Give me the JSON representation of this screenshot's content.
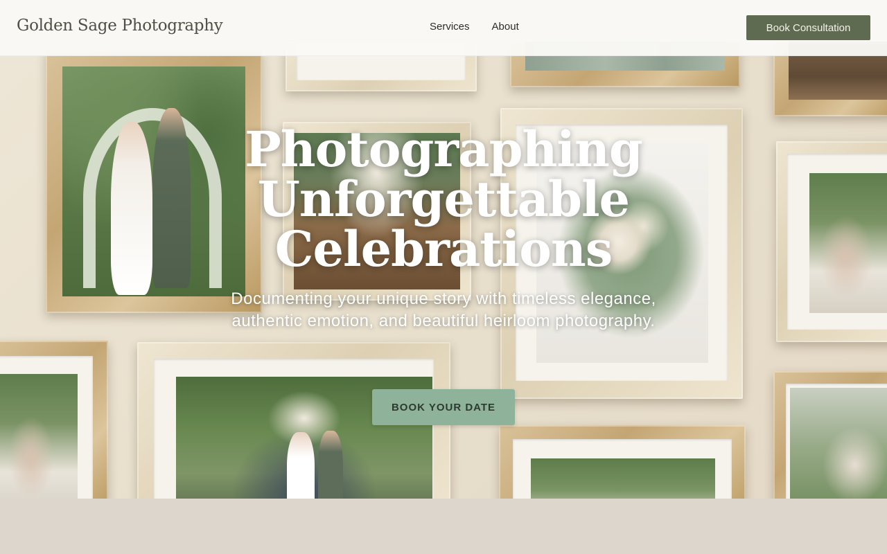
{
  "header": {
    "brand": "Golden Sage Photography",
    "nav": [
      {
        "label": "Services"
      },
      {
        "label": "About"
      }
    ],
    "cta_label": "Book Consultation"
  },
  "hero": {
    "title": "Photographing Unforgettable Celebrations",
    "subtitle": "Documenting your unique story with timeless elegance, authentic emotion, and beautiful heirloom photography.",
    "button_label": "BOOK YOUR DATE"
  },
  "colors": {
    "accent": "#5f6b50",
    "hero_button": "#8fb39a",
    "background": "#ddd6cc"
  }
}
